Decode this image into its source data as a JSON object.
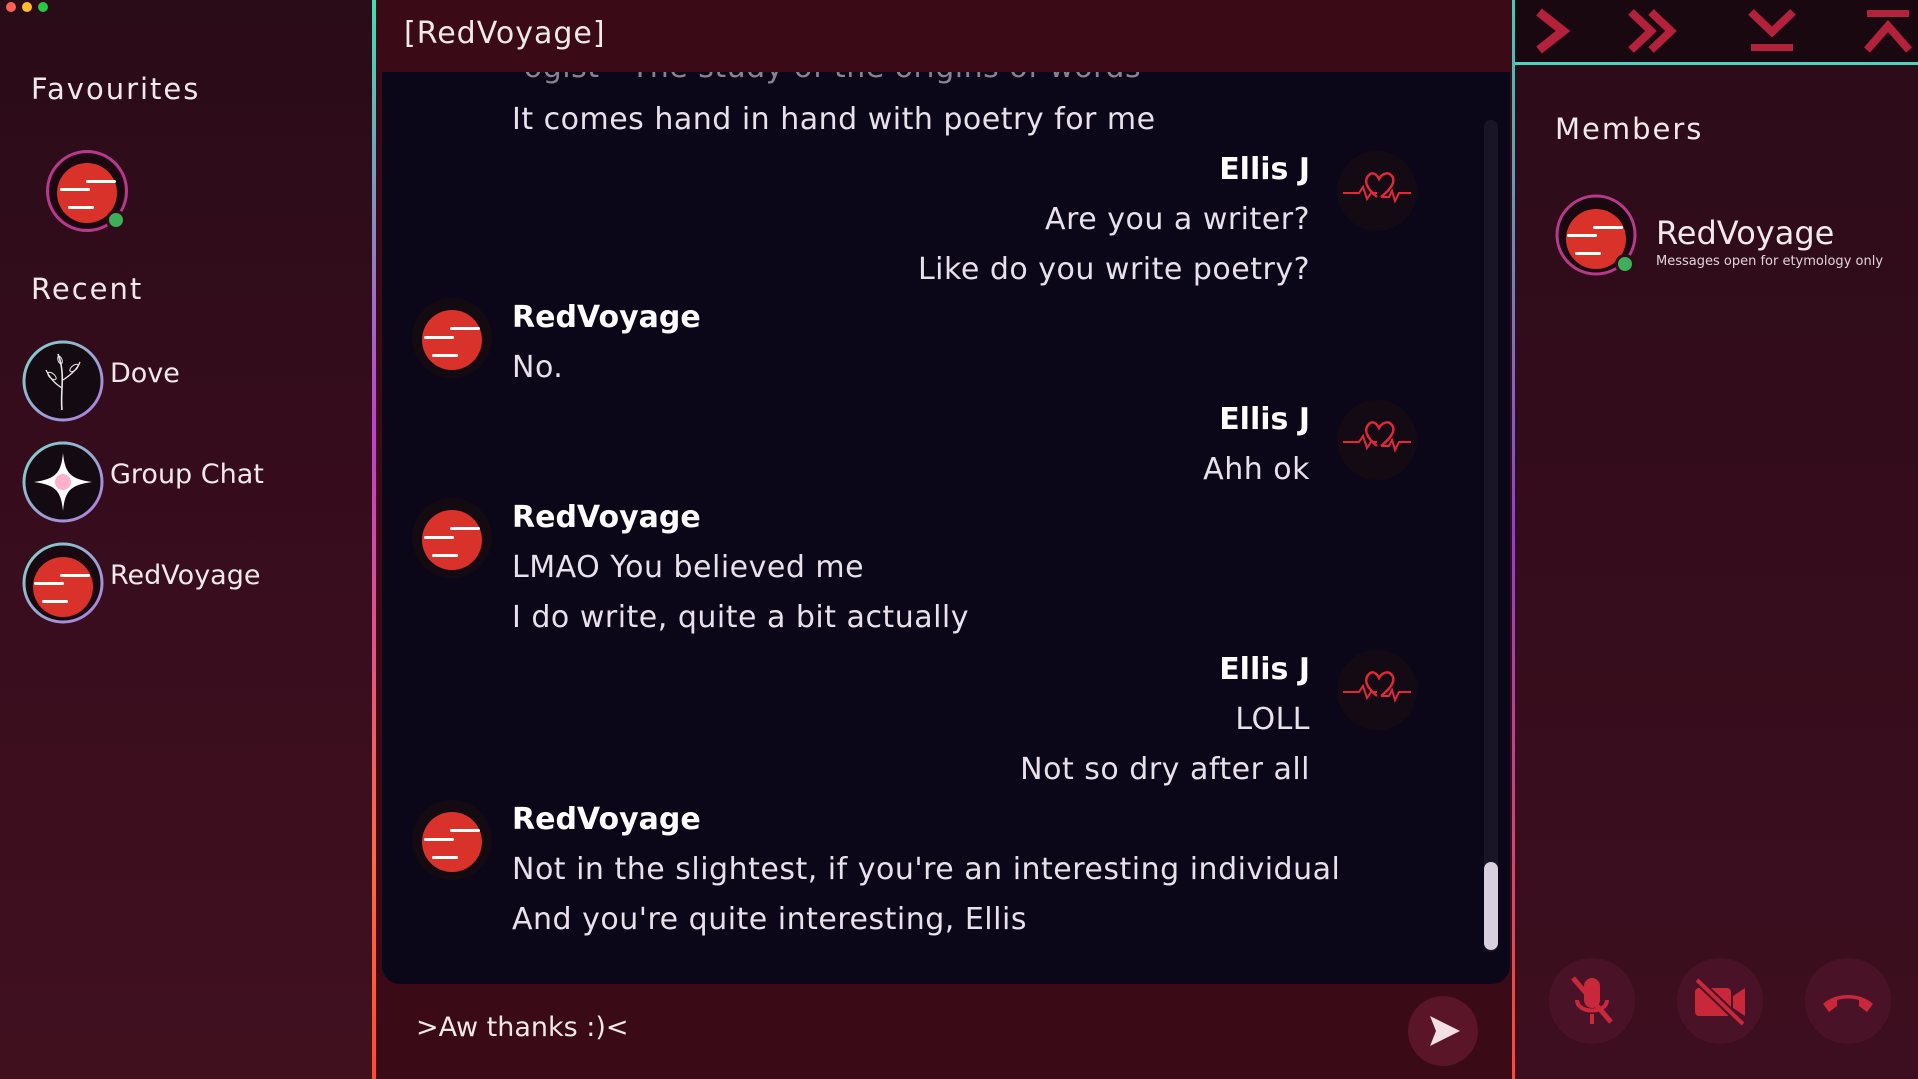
{
  "window": {
    "dot_colors": [
      "#ff5f57",
      "#febc2e",
      "#28c840"
    ]
  },
  "sidebar": {
    "favourites_title": "Favourites",
    "recent_title": "Recent",
    "recent": [
      {
        "label": "Dove",
        "icon": "plant-sketch-avatar"
      },
      {
        "label": "Group Chat",
        "icon": "sparkle-star-avatar"
      },
      {
        "label": "RedVoyage",
        "icon": "red-sun-avatar"
      }
    ]
  },
  "chat": {
    "title": "[RedVoyage]",
    "partial_line": "-ogist - The study of the origins of words",
    "messages": [
      {
        "author": "",
        "side": "left",
        "lines": [
          "It comes hand in hand with poetry for me"
        ]
      },
      {
        "author": "Ellis J",
        "side": "right",
        "lines": [
          "Are you a writer?",
          "Like do you write poetry?"
        ]
      },
      {
        "author": "RedVoyage",
        "side": "left",
        "lines": [
          "No."
        ]
      },
      {
        "author": "Ellis J",
        "side": "right",
        "lines": [
          "Ahh ok"
        ]
      },
      {
        "author": "RedVoyage",
        "side": "left",
        "lines": [
          "LMAO You believed me",
          "I do write, quite a bit actually"
        ]
      },
      {
        "author": "Ellis J",
        "side": "right",
        "lines": [
          "LOLL",
          "Not so dry after all"
        ]
      },
      {
        "author": "RedVoyage",
        "side": "left",
        "lines": [
          "Not in the slightest, if you're an interesting individual",
          "And you're quite interesting, Ellis"
        ]
      }
    ],
    "composer_value": ">Aw thanks :)<"
  },
  "members": {
    "title": "Members",
    "list": [
      {
        "name": "RedVoyage",
        "status": "Messages open for etymology only",
        "online": true
      }
    ]
  },
  "colors": {
    "accent": "#c8283a",
    "online": "#3fae5a",
    "teal": "#46d6c0"
  }
}
